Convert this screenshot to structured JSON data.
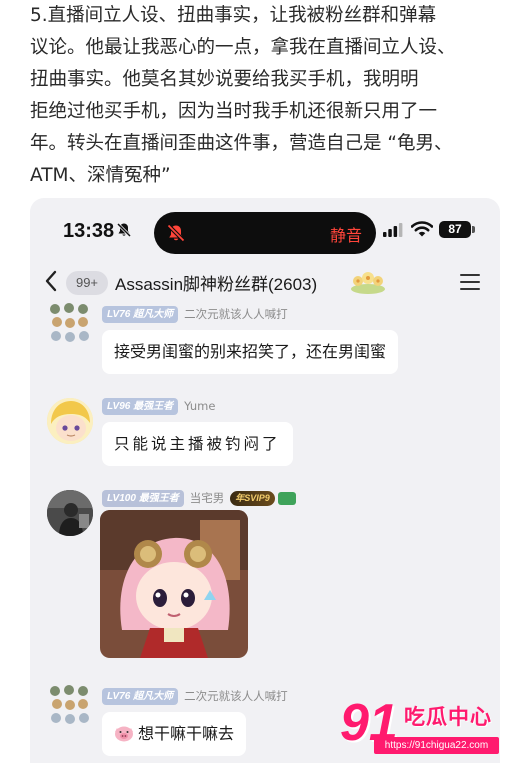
{
  "article": {
    "lines": [
      "5.直播间立人设、扭曲事实，让我被粉丝群和弹幕",
      "议论。他最让我恶心的一点，拿我在直播间立人设、",
      "扭曲事实。他莫名其妙说要给我买手机，我明明",
      "拒绝过他买手机，因为当时我手机还很新只用了一",
      "年。转头在直播间歪曲这件事，营造自己是 “龟男、",
      "ATM、深情冤种”"
    ]
  },
  "status_bar": {
    "time": "13:38",
    "island_label": "静音",
    "battery": "87",
    "icons": [
      "bell-slash-icon",
      "signal-icon",
      "wifi-icon",
      "battery-icon"
    ]
  },
  "nav": {
    "unread_badge": "99+",
    "group_title": "Assassin脚神粉丝群(2603)",
    "icons": [
      "back-chevron-icon",
      "flower-icon",
      "menu-icon"
    ]
  },
  "messages": [
    {
      "level": "LV76",
      "title": "超凡大师",
      "nickname": "二次元就该人人喊打",
      "text": "接受男闺蜜的别来招笑了，还在男闺蜜"
    },
    {
      "level": "LV96",
      "title": "最强王者",
      "nickname": "Yume",
      "text": "只能说主播被钓闷了"
    },
    {
      "level": "LV100",
      "title": "最强王者",
      "nickname": "当宅男",
      "vip": "年SVIP9",
      "sticker": "anime-girl-sticker"
    },
    {
      "level": "LV76",
      "title": "超凡大师",
      "nickname": "二次元就该人人喊打",
      "text": "想干嘛干嘛去",
      "emoji": "pig-icon"
    }
  ],
  "watermark": {
    "number": "91",
    "name": "吃瓜中心",
    "url": "https://91chigua22.com"
  },
  "colors": {
    "silent_red": "#ff453a",
    "level_badge": "#b7c4de",
    "chat_bg": "#f1f1f4",
    "watermark_pink": "#ff1a6e"
  }
}
